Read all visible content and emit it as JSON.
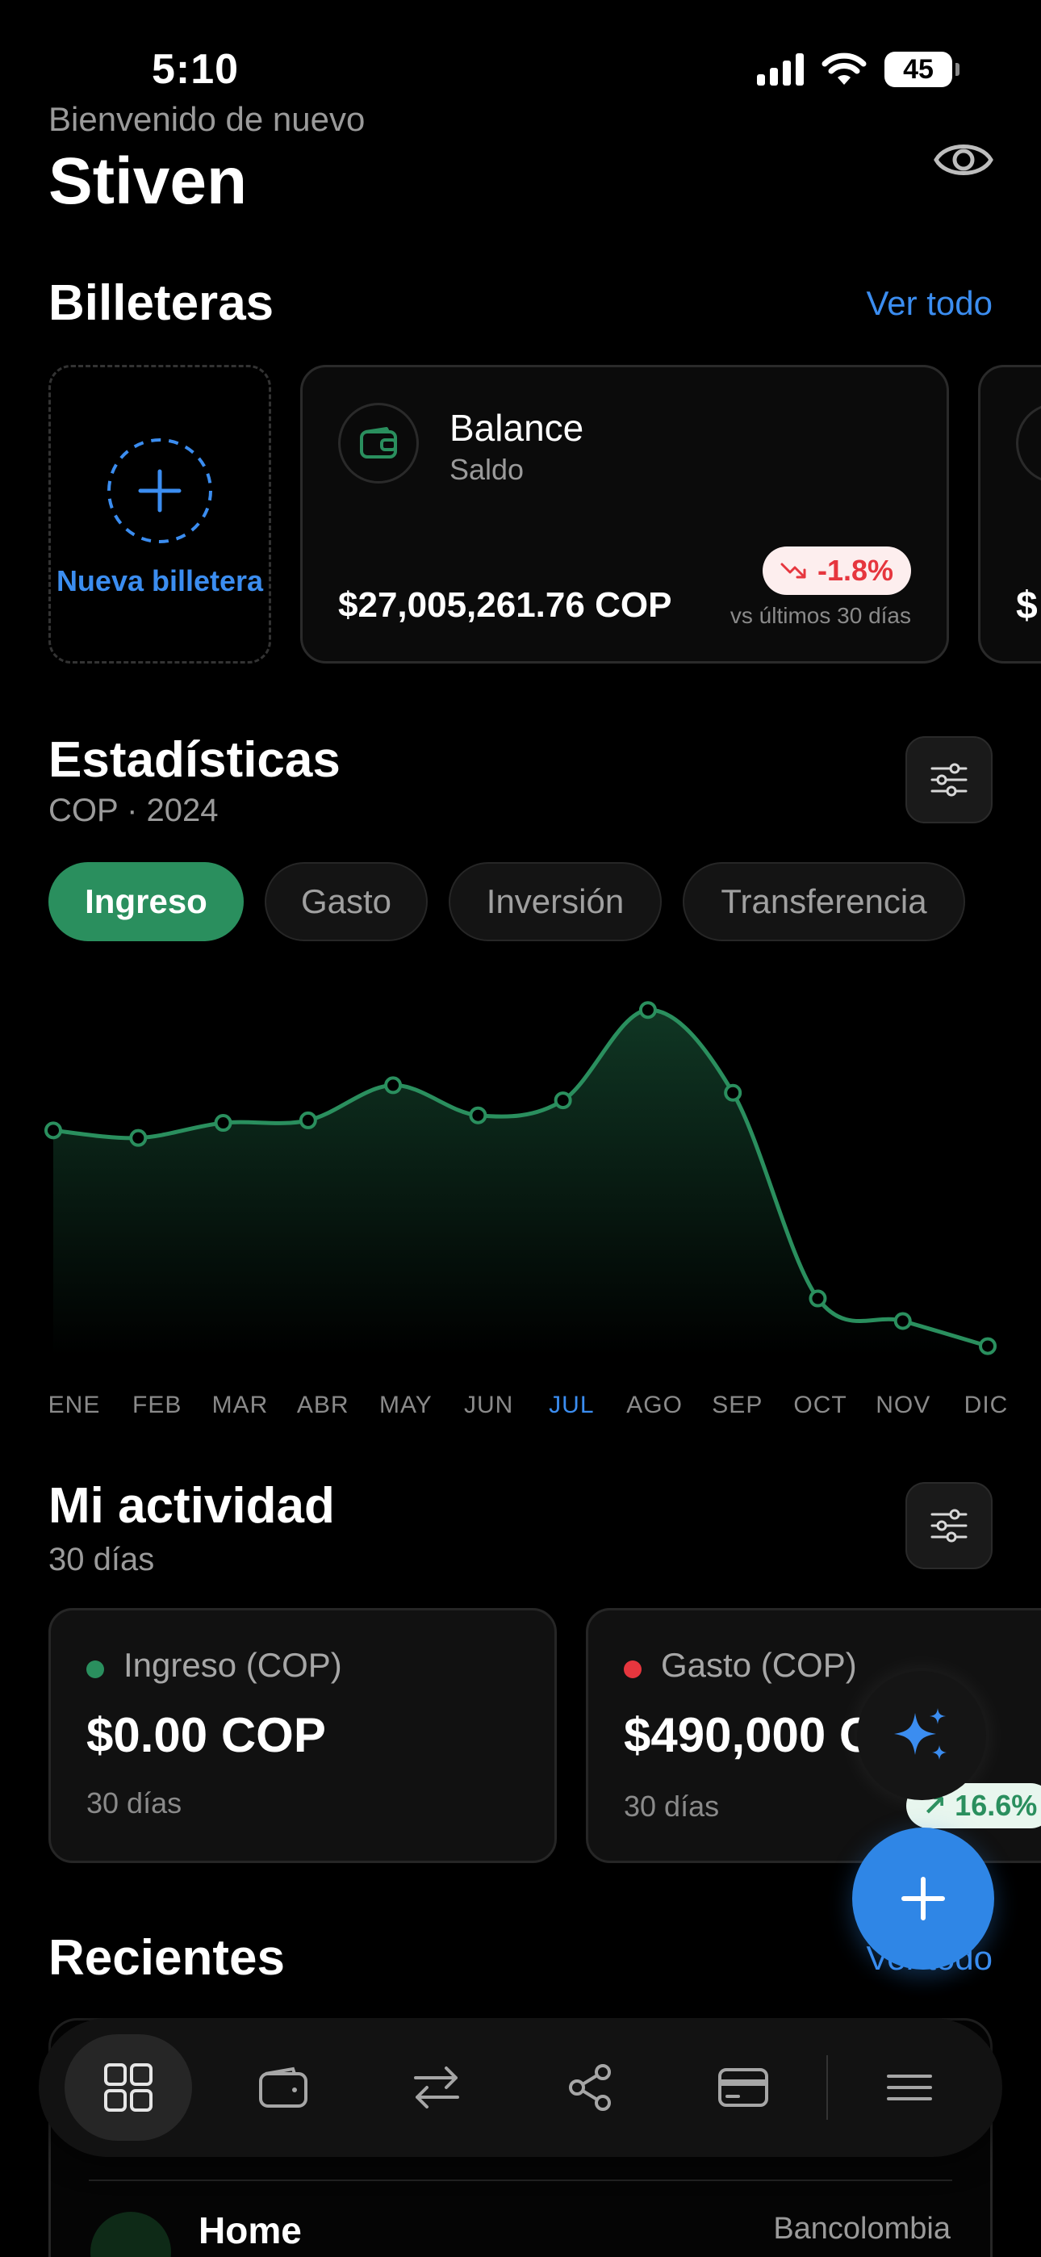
{
  "status_bar": {
    "time": "5:10",
    "battery": "45"
  },
  "header": {
    "welcome": "Bienvenido de nuevo",
    "user_name": "Stiven"
  },
  "wallets": {
    "title": "Billeteras",
    "see_all": "Ver todo",
    "new_wallet_label": "Nueva billetera",
    "cards": [
      {
        "name": "Balance",
        "type": "Saldo",
        "amount": "$27,005,261.76 COP",
        "change": "-1.8%",
        "change_period": "vs últimos 30 días"
      },
      {
        "amount": "$"
      }
    ]
  },
  "stats": {
    "title": "Estadísticas",
    "subtitle": "COP · 2024",
    "tabs": [
      "Ingreso",
      "Gasto",
      "Inversión",
      "Transferencia"
    ],
    "active_tab": "Ingreso",
    "accent_color": "#2a8f5e",
    "highlight_color": "#3b8df0"
  },
  "chart_data": {
    "type": "area",
    "categories": [
      "ENE",
      "FEB",
      "MAR",
      "ABR",
      "MAY",
      "JUN",
      "JUL",
      "AGO",
      "SEP",
      "OCT",
      "NOV",
      "DIC"
    ],
    "highlighted_category": "JUL",
    "series": [
      {
        "values": [
          70,
          67,
          73,
          74,
          88,
          76,
          82,
          118,
          85,
          3,
          -6,
          -16
        ]
      }
    ],
    "ylim": [
      -20,
      120
    ],
    "grid": false,
    "color": "#2a8f5e"
  },
  "activity": {
    "title": "Mi actividad",
    "subtitle": "30 días",
    "cards": [
      {
        "title": "Ingreso (COP)",
        "value": "$0.00 COP",
        "period": "30 días",
        "dot_color": "#2a8f5e"
      },
      {
        "title": "Gasto (COP)",
        "value": "$490,000 COP",
        "period": "30 días",
        "change": "↗ 16.6%",
        "dot_color": "#e6363e"
      }
    ]
  },
  "recents": {
    "title": "Recientes",
    "see_all": "Ver todo",
    "items": [
      {
        "name": "Home",
        "bank": "Bancolombia"
      }
    ]
  },
  "icons": {
    "eye": "eye-icon",
    "filter": "sliders-icon",
    "ai": "sparkles-icon",
    "add": "plus-icon",
    "nav": [
      "dashboard-icon",
      "wallet-icon",
      "transfer-icon",
      "share-icon",
      "card-icon",
      "menu-icon"
    ]
  }
}
